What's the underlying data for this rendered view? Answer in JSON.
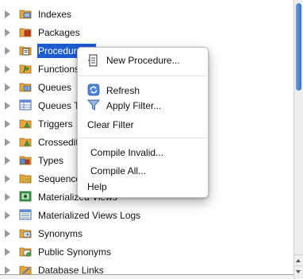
{
  "tree": {
    "items": [
      {
        "label": "Indexes",
        "icon": "indexes-icon"
      },
      {
        "label": "Packages",
        "icon": "packages-icon"
      },
      {
        "label": "Procedures",
        "icon": "procedures-icon",
        "selected": true
      },
      {
        "label": "Functions",
        "icon": "functions-icon"
      },
      {
        "label": "Queues",
        "icon": "queues-icon"
      },
      {
        "label": "Queues Tables",
        "icon": "queues-tables-icon"
      },
      {
        "label": "Triggers",
        "icon": "triggers-icon"
      },
      {
        "label": "Crossedition Triggers",
        "icon": "crossedition-triggers-icon"
      },
      {
        "label": "Types",
        "icon": "types-icon"
      },
      {
        "label": "Sequences",
        "icon": "sequences-icon"
      },
      {
        "label": "Materialized Views",
        "icon": "materialized-views-icon"
      },
      {
        "label": "Materialized Views Logs",
        "icon": "materialized-views-logs-icon"
      },
      {
        "label": "Synonyms",
        "icon": "synonyms-icon"
      },
      {
        "label": "Public Synonyms",
        "icon": "public-synonyms-icon"
      },
      {
        "label": "Database Links",
        "icon": "database-links-icon"
      }
    ]
  },
  "context_menu": {
    "new_procedure": "New Procedure...",
    "refresh": "Refresh",
    "apply_filter": "Apply Filter...",
    "clear_filter": "Clear Filter",
    "compile_invalid": "Compile Invalid...",
    "compile_all": "Compile All...",
    "help": "Help"
  },
  "colors": {
    "selection": "#1b5ccf",
    "scroll_thumb": "#3a72c9",
    "folder": "#e8a53a"
  }
}
